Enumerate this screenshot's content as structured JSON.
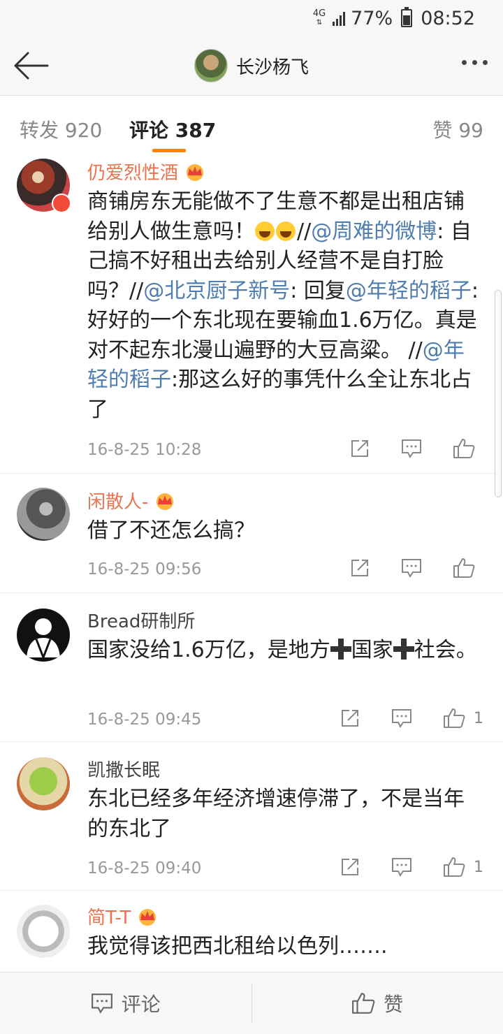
{
  "status_bar": {
    "network": "4G",
    "battery": "77%",
    "time": "08:52"
  },
  "header": {
    "title": "长沙杨飞"
  },
  "tabs": [
    {
      "label": "转发 920"
    },
    {
      "label": "评论 387"
    },
    {
      "label": "赞 99"
    }
  ],
  "comments": [
    {
      "name": "仍爱烈性酒",
      "segments": [
        {
          "t": "商铺房东无能做不了生意不都是出租店铺给别人做生意吗！"
        },
        {
          "emoji": "laugh"
        },
        {
          "emoji": "laugh"
        },
        {
          "t": "//"
        },
        {
          "m": "@周难的微博"
        },
        {
          "t": ": 自己搞不好租出去给别人经营不是自打脸吗？//"
        },
        {
          "m": "@北京厨子新号"
        },
        {
          "t": ": 回复"
        },
        {
          "m": "@年轻的稻子"
        },
        {
          "t": ": 好好的一个东北现在要输血1.6万亿。真是对不起东北漫山遍野的大豆高粱。 //"
        },
        {
          "m": "@年轻的稻子"
        },
        {
          "t": ":那这么好的事凭什么全让东北占了"
        }
      ],
      "time": "16-8-25 10:28",
      "likes": ""
    },
    {
      "name": "闲散人-",
      "segments": [
        {
          "t": "借了不还怎么搞？"
        }
      ],
      "time": "16-8-25 09:56",
      "likes": ""
    },
    {
      "name": "Bread研制所",
      "segments": [
        {
          "t": "国家没给1.6万亿，是地方"
        },
        {
          "plus": true
        },
        {
          "t": "国家"
        },
        {
          "plus": true
        },
        {
          "t": "社会。"
        }
      ],
      "time": "16-8-25 09:45",
      "likes": "1"
    },
    {
      "name": "凯撒长眠",
      "segments": [
        {
          "t": "东北已经多年经济增速停滞了，不是当年的东北了"
        }
      ],
      "time": "16-8-25 09:40",
      "likes": "1"
    },
    {
      "name": "简T-T",
      "segments": [
        {
          "t": "我觉得该把西北租给以色列……."
        }
      ],
      "time": "",
      "likes": ""
    }
  ],
  "bottom_bar": {
    "comment_label": "评论",
    "like_label": "赞"
  },
  "colors": {
    "accent": "#ff8200",
    "vip_name": "#eb7350",
    "mention": "#507daf"
  }
}
